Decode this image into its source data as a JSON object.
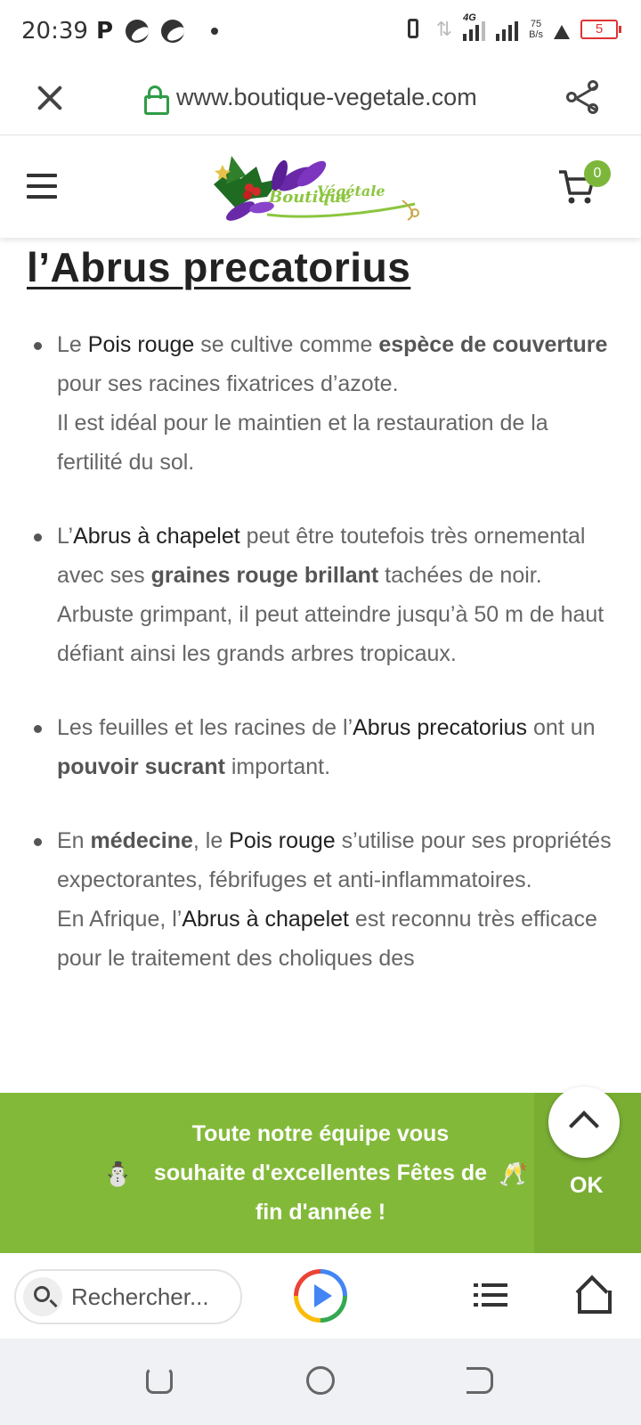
{
  "status_bar": {
    "time": "20:39",
    "network": "4G",
    "speed_value": "75",
    "speed_unit": "B/s",
    "battery": "5"
  },
  "browser": {
    "url": "www.boutique-vegetale.com"
  },
  "site": {
    "logo_text_1": "Boutique",
    "logo_text_2": "Végétale",
    "cart_count": "0"
  },
  "article": {
    "title": "l’Abrus precatorius",
    "bullets": [
      {
        "p1": [
          {
            "t": "Le ",
            "s": "n"
          },
          {
            "t": "Pois rouge",
            "s": "d"
          },
          {
            "t": " se cultive comme ",
            "s": "n"
          },
          {
            "t": "espèce de couverture",
            "s": "b"
          },
          {
            "t": " pour ses racines fixatrices d’azote.",
            "s": "n"
          }
        ],
        "p2": "Il est idéal pour le maintien et la restauration de la  fertilité du sol."
      },
      {
        "p1": [
          {
            "t": "L’",
            "s": "n"
          },
          {
            "t": "Abrus à chapelet",
            "s": "d"
          },
          {
            "t": " peut être toutefois très ornemental avec ses ",
            "s": "n"
          },
          {
            "t": "graines rouge brillant",
            "s": "b"
          },
          {
            "t": " tachées de noir.",
            "s": "n"
          }
        ],
        "p2": "Arbuste grimpant, il peut atteindre jusqu’à 50 m de haut défiant ainsi les grands arbres tropicaux."
      },
      {
        "p1": [
          {
            "t": "Les feuilles et les racines de l’",
            "s": "n"
          },
          {
            "t": "Abrus precatorius",
            "s": "d"
          },
          {
            "t": " ont un ",
            "s": "n"
          },
          {
            "t": "pouvoir sucrant",
            "s": "b"
          },
          {
            "t": " important.",
            "s": "n"
          }
        ],
        "p2": ""
      },
      {
        "p1": [
          {
            "t": "En ",
            "s": "n"
          },
          {
            "t": "médecine",
            "s": "b"
          },
          {
            "t": ", le ",
            "s": "n"
          },
          {
            "t": "Pois rouge",
            "s": "d"
          },
          {
            "t": " s’utilise pour ses propriétés expectorantes, fébrifuges et anti-inflammatoires.",
            "s": "n"
          }
        ],
        "p2_parts": [
          {
            "t": "En Afrique, l’",
            "s": "n"
          },
          {
            "t": "Abrus à chapelet",
            "s": "d"
          },
          {
            "t": " est reconnu très efficace pour le traitement des choliques des",
            "s": "n"
          }
        ]
      }
    ]
  },
  "banner": {
    "line1": "Toute notre équipe vous",
    "line2": "souhaite d'excellentes Fêtes de",
    "line3": "fin d'année !",
    "ok_label": "OK"
  },
  "toolbar": {
    "search_placeholder": "Rechercher..."
  },
  "icons": {
    "status_left": [
      "p-icon",
      "bird-icon",
      "bird-icon",
      "dot-icon"
    ],
    "status_right": [
      "vibrate-icon",
      "data-arrows-icon",
      "signal-icon",
      "signal-icon",
      "flask-icon",
      "battery-icon"
    ],
    "browser": [
      "close-icon",
      "lock-icon",
      "share-icon"
    ],
    "header": [
      "menu-icon",
      "cart-icon"
    ],
    "banner": [
      "people-icon",
      "champagne-icon",
      "chevron-up-icon"
    ],
    "toolbar": [
      "search-icon",
      "play-icon",
      "list-icon",
      "home-icon"
    ],
    "nav": [
      "recents-icon",
      "home-circle-icon",
      "back-icon"
    ]
  },
  "colors": {
    "accent_green": "#83b939",
    "lock_green": "#2e9d45",
    "battery_red": "#dd3333"
  }
}
